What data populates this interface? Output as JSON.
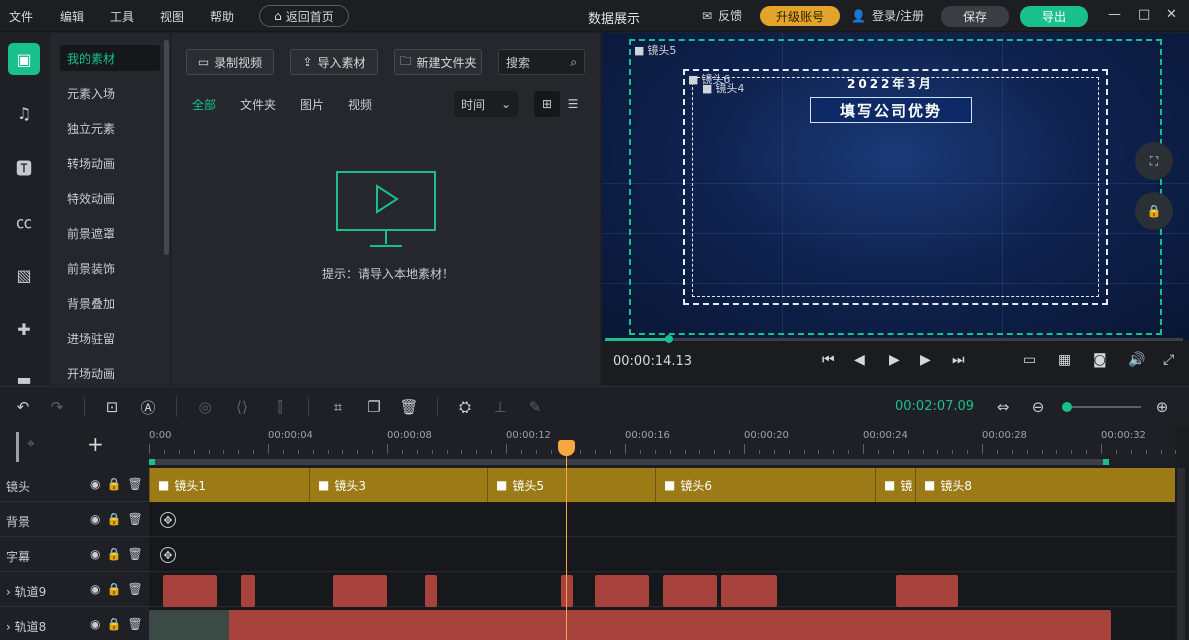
{
  "menu": [
    "文件",
    "编辑",
    "工具",
    "视图",
    "帮助"
  ],
  "home_button": "返回首页",
  "app_title": "数据展示",
  "feedback": "反馈",
  "upgrade": "升级账号",
  "login": "登录/注册",
  "save": "保存",
  "export": "导出",
  "categories": [
    "我的素材",
    "元素入场",
    "独立元素",
    "转场动画",
    "特效动画",
    "前景遮罩",
    "前景装饰",
    "背景叠加",
    "进场驻留",
    "开场动画"
  ],
  "media": {
    "record": "录制视频",
    "import": "导入素材",
    "new_folder": "新建文件夹",
    "search_placeholder": "搜索",
    "filters": [
      "全部",
      "文件夹",
      "图片",
      "视频"
    ],
    "sort": "时间",
    "empty_hint": "提示：请导入本地素材！"
  },
  "preview": {
    "shot_labels": [
      "镜头5",
      "镜头6",
      "镜头4"
    ],
    "year": "2022年3月",
    "title": "填写公司优势",
    "current_time": "00:00:14.13",
    "progress": 0.11
  },
  "toolbar": {
    "total_time": "00:02:07.09",
    "zoom": 0.05
  },
  "timeline": {
    "ticks": [
      "0:00",
      "00:00:04",
      "00:00:08",
      "00:00:12",
      "00:00:16",
      "00:00:20",
      "00:00:24",
      "00:00:28",
      "00:00:32"
    ],
    "tracks": [
      "镜头",
      "背景",
      "字幕",
      "轨道9",
      "轨道8"
    ],
    "clips": [
      "镜头1",
      "镜头3",
      "镜头5",
      "镜头6",
      "镜",
      "镜头8"
    ]
  },
  "colors": {
    "accent": "#19c08c",
    "upgrade": "#e2a42b",
    "clip": "#9c7a15",
    "audio": "#a8423c",
    "playhead": "#f5a742"
  }
}
